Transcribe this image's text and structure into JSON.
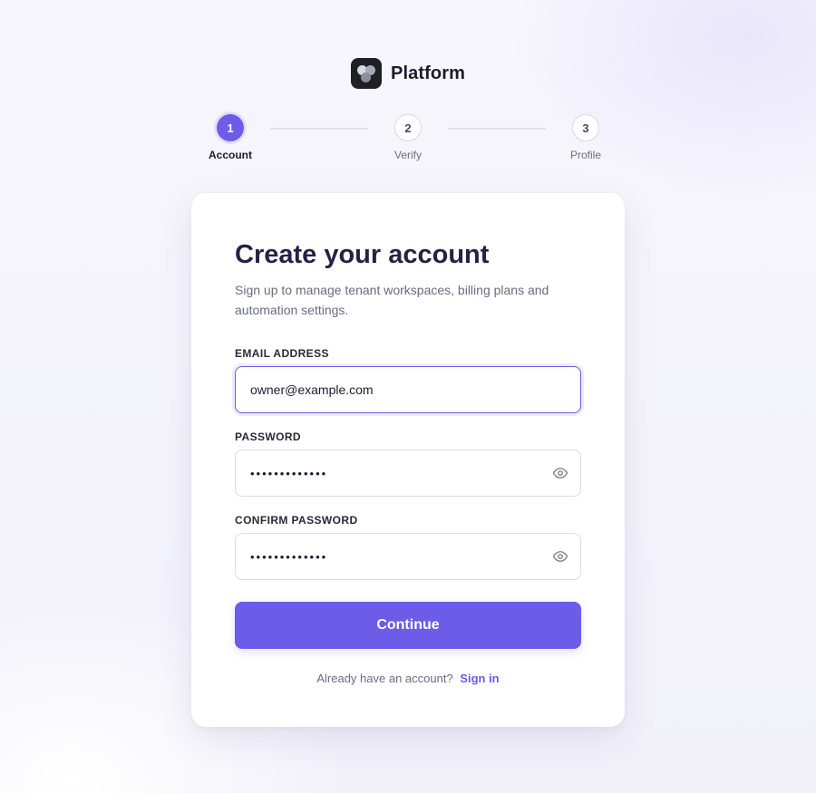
{
  "brand": {
    "name": "Platform",
    "logo_icon": "platform-logo-icon"
  },
  "stepper": {
    "current_step": 1,
    "steps": [
      {
        "number": "1",
        "label": "Account",
        "state": "active"
      },
      {
        "number": "2",
        "label": "Verify",
        "state": "upcoming"
      },
      {
        "number": "3",
        "label": "Profile",
        "state": "upcoming"
      }
    ]
  },
  "form": {
    "title": "Create your account",
    "subtitle": "Sign up to manage tenant workspaces, billing plans and automation settings.",
    "email": {
      "label": "EMAIL ADDRESS",
      "value": "owner@example.com"
    },
    "password": {
      "label": "PASSWORD",
      "value": "•••••••••••••",
      "toggle_icon": "eye-icon"
    },
    "confirm_password": {
      "label": "CONFIRM PASSWORD",
      "value": "•••••••••••••",
      "toggle_icon": "eye-icon"
    },
    "submit_label": "Continue",
    "signin_prompt": "Already have an account?",
    "signin_link": "Sign in"
  },
  "colors": {
    "accent": "#6c5ce7",
    "title": "#2a1f44",
    "muted": "#6a6b80",
    "background": "#f5f4fb"
  }
}
